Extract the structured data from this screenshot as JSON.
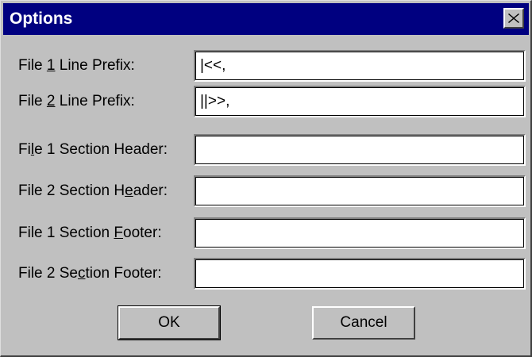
{
  "window": {
    "title": "Options",
    "close_icon": "close-x-icon"
  },
  "fields": [
    {
      "label_pre": "File ",
      "label_key": "1",
      "label_post": " Line Prefix:",
      "value": "|<<,"
    },
    {
      "label_pre": "File ",
      "label_key": "2",
      "label_post": " Line Prefix:",
      "value": "||>>,"
    },
    {
      "label_pre": "Fi",
      "label_key": "l",
      "label_post": "e 1 Section Header:",
      "value": ""
    },
    {
      "label_pre": "File 2 Section H",
      "label_key": "e",
      "label_post": "ader:",
      "value": ""
    },
    {
      "label_pre": "File 1 Section ",
      "label_key": "F",
      "label_post": "ooter:",
      "value": ""
    },
    {
      "label_pre": "File 2 Se",
      "label_key": "c",
      "label_post": "tion Footer:",
      "value": ""
    }
  ],
  "buttons": {
    "ok_label": "OK",
    "cancel_label": "Cancel"
  }
}
